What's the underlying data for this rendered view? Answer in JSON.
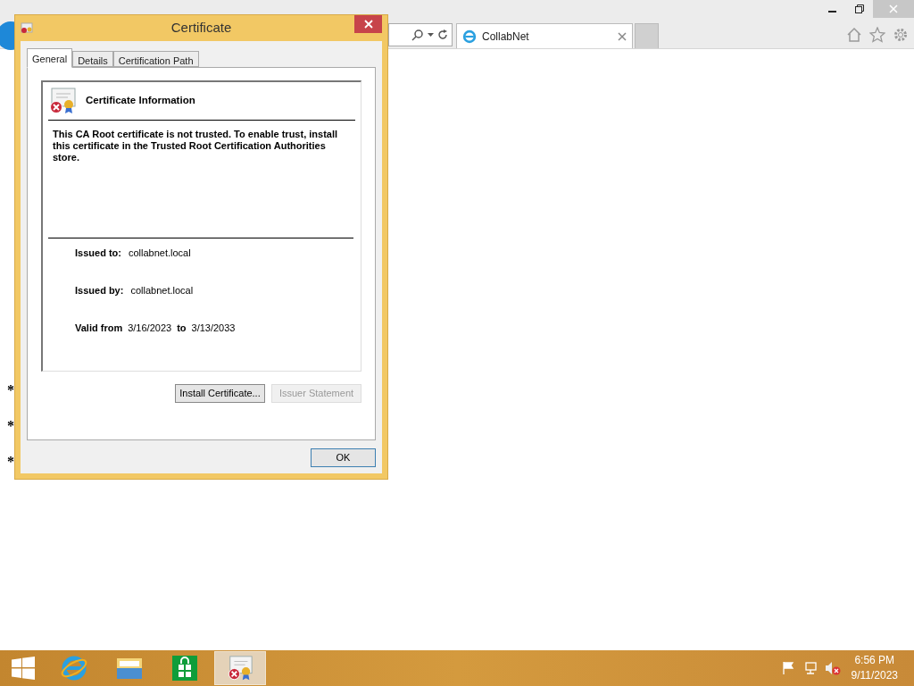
{
  "browser": {
    "tab": {
      "title": "CollabNet"
    },
    "page_fragments": [
      {
        "text": "*",
        "kind": "bullet"
      },
      {
        "text": "*",
        "kind": "bullet"
      },
      {
        "text": "*",
        "kind": "bullet"
      }
    ]
  },
  "dialog": {
    "title": "Certificate",
    "tabs": [
      {
        "label": "General",
        "selected": true
      },
      {
        "label": "Details",
        "selected": false
      },
      {
        "label": "Certification Path",
        "selected": false
      }
    ],
    "heading": "Certificate Information",
    "message": "This CA Root certificate is not trusted. To enable trust, install this certificate in the Trusted Root Certification Authorities store.",
    "issued_to": {
      "label": "Issued to:",
      "value": "collabnet.local"
    },
    "issued_by": {
      "label": "Issued by:",
      "value": "collabnet.local"
    },
    "validity": {
      "label": "Valid from",
      "from": "3/16/2023",
      "to_label": "to",
      "to": "3/13/2033"
    },
    "buttons": [
      {
        "label": "Install Certificate...",
        "disabled": false
      },
      {
        "label": "Issuer Statement",
        "disabled": true
      }
    ],
    "ok": "OK"
  },
  "taskbar": {
    "apps": [
      {
        "kind": "browser",
        "selected": false
      },
      {
        "kind": "folder",
        "selected": false
      },
      {
        "kind": "store",
        "selected": false
      },
      {
        "kind": "certificate",
        "selected": true
      }
    ],
    "time": "6:56 PM",
    "date": "9/11/2023"
  }
}
